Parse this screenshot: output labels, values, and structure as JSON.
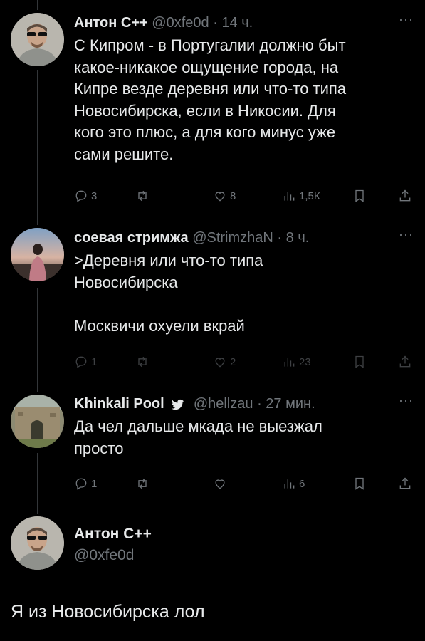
{
  "tweets": [
    {
      "name": "Антон С++",
      "handle": "@0xfe0d",
      "time": "14 ч.",
      "text": "С Кипром - в Португалии должно быт\nкакое-никакое ощущение города, на\nКипре везде деревня или что-то типа\nНовосибирска, если в Никосии. Для\nкого это плюс, а для кого минус уже\nсами решите.",
      "replies": "3",
      "retweets": "",
      "likes": "8",
      "views": "1,5К"
    },
    {
      "name": "соевая стримжа",
      "handle": "@StrimzhaN",
      "time": "8 ч.",
      "text": ">Деревня или что-то типа\nНовосибирска\n\nМосквичи охуели вкрай",
      "replies": "1",
      "retweets": "",
      "likes": "2",
      "views": "23"
    },
    {
      "name": "Khinkali Pool",
      "handle": "@hellzau",
      "time": "27 мин.",
      "text": "Да чел дальше мкада не выезжал\nпросто",
      "replies": "1",
      "retweets": "",
      "likes": "",
      "views": "6"
    }
  ],
  "main": {
    "name": "Антон С++",
    "handle": "@0xfe0d",
    "text": "Я из Новосибирска лол"
  },
  "more_label": "···",
  "separator": "·",
  "icons": [
    "reply-icon",
    "retweet-icon",
    "like-icon",
    "views-icon",
    "bookmark-icon",
    "share-icon",
    "verified-icon",
    "more-icon"
  ],
  "colors": {
    "background": "#000000",
    "text": "#e7e9ea",
    "secondary": "#71767b",
    "line": "#333639"
  }
}
